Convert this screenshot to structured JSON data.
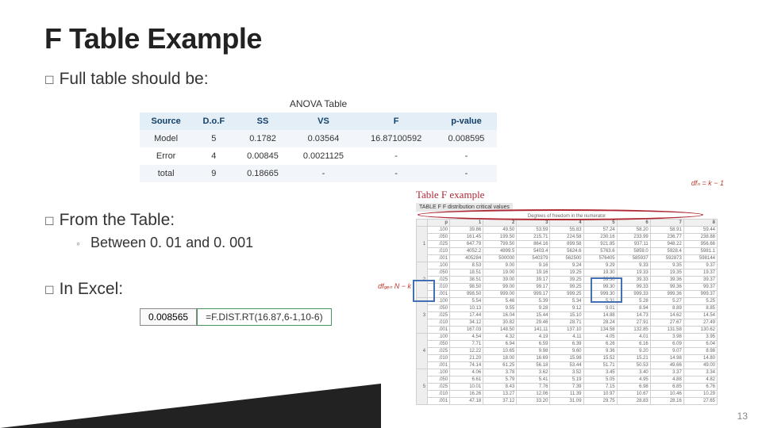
{
  "title": "F Table Example",
  "bullets": {
    "full": "Full",
    "full_rest": " table should be:",
    "from": "From",
    "from_rest": " the Table:",
    "between": "Between 0. 01 and 0. 001",
    "in": "In",
    "in_rest": " Excel:"
  },
  "anova": {
    "caption": "ANOVA Table",
    "headers": [
      "Source",
      "D.o.F",
      "SS",
      "VS",
      "F",
      "p-value"
    ],
    "rows": [
      [
        "Model",
        "5",
        "0.1782",
        "0.03564",
        "16.87100592",
        "0.008595"
      ],
      [
        "Error",
        "4",
        "0.00845",
        "0.0021125",
        "-",
        "-"
      ],
      [
        "total",
        "9",
        "0.18665",
        "-",
        "-",
        "-"
      ]
    ]
  },
  "ftable": {
    "title": "Table F example",
    "subtitle": "TABLE F  F distribution critical values",
    "df_num_label": "dfₙ = k − 1",
    "df_den_label": "df₉ₑₙ\nN − k",
    "numerator_header": "Degrees of freedom in the numerator",
    "left_header": [
      "p",
      ".100",
      ".050",
      ".025",
      ".010",
      ".001",
      ".100",
      ".050",
      ".025",
      ".010",
      ".001",
      ".100",
      ".050",
      ".025",
      ".010",
      ".001",
      ".100",
      ".050",
      ".025",
      ".010",
      ".001",
      ".100",
      ".050",
      ".025",
      ".010",
      ".001"
    ],
    "den_labels": [
      "1",
      "2",
      "3",
      "4",
      "5"
    ],
    "cols": [
      "1",
      "2",
      "3",
      "4",
      "5",
      "6",
      "7",
      "8"
    ],
    "body": [
      [
        "39.86",
        "49.50",
        "53.59",
        "55.83",
        "57.24",
        "58.20",
        "58.91",
        "59.44"
      ],
      [
        "161.45",
        "199.50",
        "215.71",
        "224.58",
        "230.16",
        "233.99",
        "236.77",
        "238.88"
      ],
      [
        "647.79",
        "799.50",
        "864.16",
        "899.58",
        "921.85",
        "937.11",
        "948.22",
        "956.66"
      ],
      [
        "4052.2",
        "4999.5",
        "5403.4",
        "5624.6",
        "5763.6",
        "5859.0",
        "5928.4",
        "5981.1"
      ],
      [
        "405284",
        "500000",
        "540379",
        "562500",
        "576405",
        "585937",
        "592873",
        "598144"
      ],
      [
        "8.53",
        "9.00",
        "9.16",
        "9.24",
        "9.29",
        "9.33",
        "9.35",
        "9.37"
      ],
      [
        "18.51",
        "19.00",
        "19.16",
        "19.25",
        "19.30",
        "19.33",
        "19.35",
        "19.37"
      ],
      [
        "38.51",
        "39.00",
        "39.17",
        "39.25",
        "39.30",
        "39.33",
        "39.36",
        "39.37"
      ],
      [
        "98.50",
        "99.00",
        "99.17",
        "99.25",
        "99.30",
        "99.33",
        "99.36",
        "99.37"
      ],
      [
        "998.50",
        "999.00",
        "999.17",
        "999.25",
        "999.30",
        "999.33",
        "999.36",
        "999.37"
      ],
      [
        "5.54",
        "5.46",
        "5.39",
        "5.34",
        "5.31",
        "5.28",
        "5.27",
        "5.25"
      ],
      [
        "10.13",
        "9.55",
        "9.28",
        "9.12",
        "9.01",
        "8.94",
        "8.89",
        "8.85"
      ],
      [
        "17.44",
        "16.04",
        "15.44",
        "15.10",
        "14.88",
        "14.73",
        "14.62",
        "14.54"
      ],
      [
        "34.12",
        "30.82",
        "29.46",
        "28.71",
        "28.24",
        "27.91",
        "27.67",
        "27.49"
      ],
      [
        "167.03",
        "148.50",
        "141.11",
        "137.10",
        "134.58",
        "132.85",
        "131.58",
        "130.62"
      ],
      [
        "4.54",
        "4.32",
        "4.19",
        "4.11",
        "4.05",
        "4.01",
        "3.98",
        "3.95"
      ],
      [
        "7.71",
        "6.94",
        "6.59",
        "6.39",
        "6.26",
        "6.16",
        "6.09",
        "6.04"
      ],
      [
        "12.22",
        "10.65",
        "9.98",
        "9.60",
        "9.36",
        "9.20",
        "9.07",
        "8.98"
      ],
      [
        "21.20",
        "18.00",
        "16.69",
        "15.98",
        "15.52",
        "15.21",
        "14.98",
        "14.80"
      ],
      [
        "74.14",
        "61.25",
        "56.18",
        "53.44",
        "51.71",
        "50.53",
        "49.66",
        "49.00"
      ],
      [
        "4.06",
        "3.78",
        "3.62",
        "3.52",
        "3.45",
        "3.40",
        "3.37",
        "3.34"
      ],
      [
        "6.61",
        "5.79",
        "5.41",
        "5.19",
        "5.05",
        "4.95",
        "4.88",
        "4.82"
      ],
      [
        "10.01",
        "8.43",
        "7.76",
        "7.39",
        "7.15",
        "6.98",
        "6.85",
        "6.76"
      ],
      [
        "16.26",
        "13.27",
        "12.06",
        "11.39",
        "10.97",
        "10.67",
        "10.46",
        "10.29"
      ],
      [
        "47.18",
        "37.12",
        "33.20",
        "31.09",
        "29.75",
        "28.83",
        "28.16",
        "27.65"
      ]
    ]
  },
  "excel": {
    "result": "0.008565",
    "formula": "=F.DIST.RT(16.87,6-1,10-6)"
  },
  "page_number": "13",
  "chart_data": {
    "type": "table",
    "title": "ANOVA Table",
    "columns": [
      "Source",
      "D.o.F",
      "SS",
      "VS",
      "F",
      "p-value"
    ],
    "rows": [
      {
        "Source": "Model",
        "D.o.F": 5,
        "SS": 0.1782,
        "VS": 0.03564,
        "F": 16.87100592,
        "p-value": 0.008595
      },
      {
        "Source": "Error",
        "D.o.F": 4,
        "SS": 0.00845,
        "VS": 0.0021125,
        "F": null,
        "p-value": null
      },
      {
        "Source": "total",
        "D.o.F": 9,
        "SS": 0.18665,
        "VS": null,
        "F": null,
        "p-value": null
      }
    ]
  }
}
